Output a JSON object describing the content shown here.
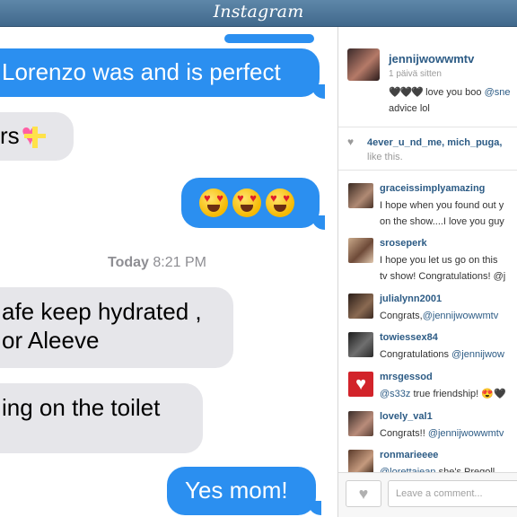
{
  "header": {
    "logo": "Instagram"
  },
  "messages": {
    "lorenzo": "Lorenzo was and is perfect",
    "irs": "rs",
    "timestamp_day": "Today",
    "timestamp_time": "8:21 PM",
    "hydrate_line1": "afe keep hydrated ,",
    "hydrate_line2": "or Aleeve",
    "toilet": "ing on the toilet",
    "reply": "Yes mom!"
  },
  "post": {
    "username": "jennijwowwmtv",
    "time": "1 päivä sitten",
    "caption_hearts": "🖤🖤🖤",
    "caption_text": " love you boo ",
    "caption_mention": "@sne",
    "caption_line2": "advice lol",
    "likes_users": "4ever_u_nd_me, mich_puga,",
    "likes_suffix": "like this."
  },
  "comments": [
    {
      "user": "graceissimplyamazing",
      "text": "I hope when you found out y",
      "text2": "on the show....I love you guy"
    },
    {
      "user": "sroseperk",
      "text": "I hope you let us go on this",
      "text2": "tv show! Congratulations! @j"
    },
    {
      "user": "julialynn2001",
      "text": "Congrats,",
      "mention": "@jennijwowwmtv"
    },
    {
      "user": "towiessex84",
      "text": "Congratulations ",
      "mention": "@jennijwow"
    },
    {
      "user": "mrsgessod",
      "mention": "@s33z",
      "text": " true friendship! 😍🖤"
    },
    {
      "user": "lovely_val1",
      "text": "Congrats!! ",
      "mention": "@jennijwowwmtv"
    },
    {
      "user": "ronmarieeee",
      "mention": "@lorettajean",
      "text": " she's Pregoll"
    }
  ],
  "comment_bar": {
    "placeholder": "Leave a comment..."
  },
  "colors": {
    "header": "#4f7aa0",
    "bubble_out": "#2b8ff0",
    "bubble_in": "#e6e6ea",
    "link": "#2c5b85"
  }
}
